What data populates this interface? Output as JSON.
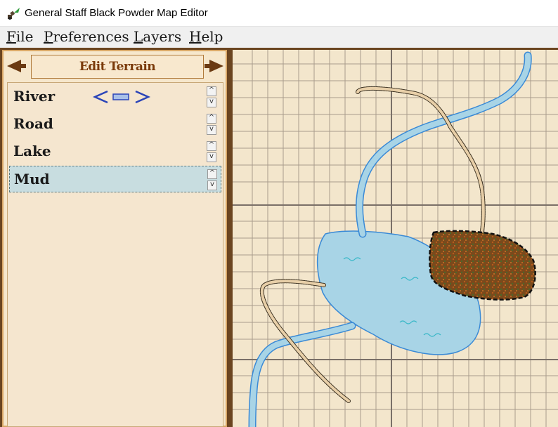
{
  "window": {
    "title": "General Staff Black Powder Map Editor"
  },
  "menu": {
    "file": "File",
    "preferences": "Preferences",
    "layers": "Layers",
    "help": "Help"
  },
  "panel": {
    "title": "Edit Terrain"
  },
  "terrain": {
    "items": [
      {
        "label": "River"
      },
      {
        "label": "Road"
      },
      {
        "label": "Lake"
      },
      {
        "label": "Mud"
      }
    ],
    "selected": "Mud"
  },
  "colors": {
    "frame": "#6b4520",
    "parchment": "#f3e6cc",
    "water": "#a8d4e6",
    "water_edge": "#3a8ad6",
    "road": "#e8cfa8",
    "mud": "#7a4a1c",
    "selection": "#c8dde0"
  },
  "icons": {
    "app": "cannon-icon",
    "river_style": "double-arrow-line-icon"
  }
}
